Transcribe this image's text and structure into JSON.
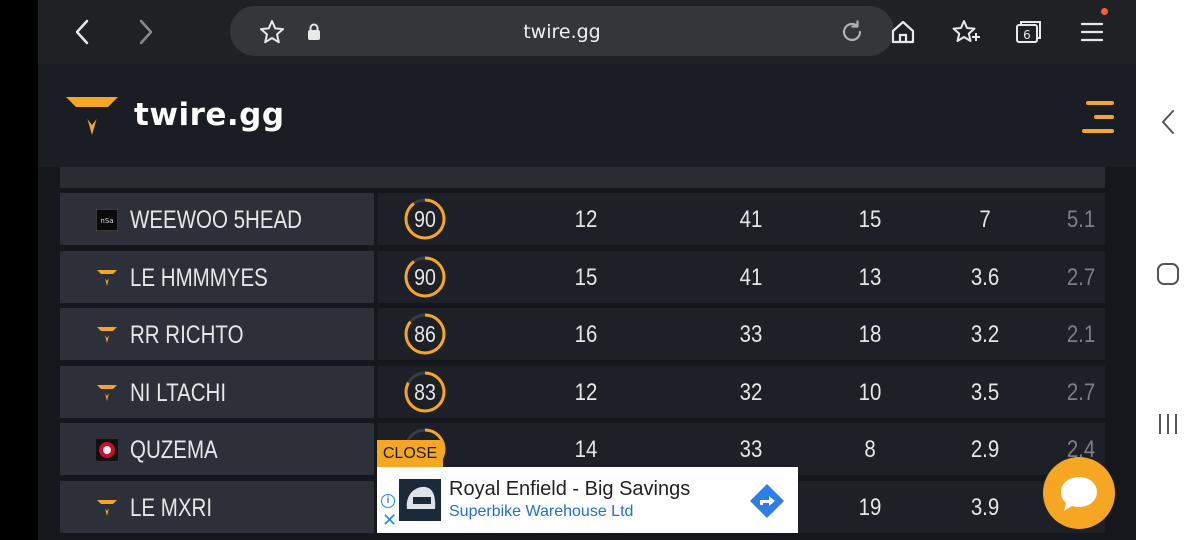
{
  "browser": {
    "url": "twire.gg",
    "tab_count": "6",
    "icons": [
      "back-arrow-icon",
      "forward-arrow-icon",
      "star-icon",
      "lock-icon",
      "reload-icon",
      "home-icon",
      "bookmark-add-icon",
      "tabs-icon",
      "menu-icon"
    ]
  },
  "site": {
    "logo_text": "twire.gg",
    "accent": "#f5a623"
  },
  "table": {
    "rows": [
      {
        "name": "WEEWOO 5HEAD",
        "logo": "nSa",
        "rating": "90",
        "rating_pct": 0.9,
        "col1": "12",
        "col2": "41",
        "col3": "15",
        "col4": "7",
        "col5": "5.1"
      },
      {
        "name": "LE HMMMYES",
        "logo": "twire",
        "rating": "90",
        "rating_pct": 0.9,
        "col1": "15",
        "col2": "41",
        "col3": "13",
        "col4": "3.6",
        "col5": "2.7"
      },
      {
        "name": "RR RICHTO",
        "logo": "twire",
        "rating": "86",
        "rating_pct": 0.86,
        "col1": "16",
        "col2": "33",
        "col3": "18",
        "col4": "3.2",
        "col5": "2.1"
      },
      {
        "name": "NI LTACHI",
        "logo": "twire",
        "rating": "83",
        "rating_pct": 0.83,
        "col1": "12",
        "col2": "32",
        "col3": "10",
        "col4": "3.5",
        "col5": "2.7"
      },
      {
        "name": "QUZEMA",
        "logo": "round",
        "rating": "",
        "rating_pct": 0.8,
        "col1": "14",
        "col2": "33",
        "col3": "8",
        "col4": "2.9",
        "col5": "2.4"
      },
      {
        "name": "LE MXRI",
        "logo": "twire",
        "rating": "",
        "rating_pct": 0.8,
        "col1": "",
        "col2": "",
        "col3": "19",
        "col4": "3.9",
        "col5": ""
      }
    ]
  },
  "ad": {
    "close_label": "CLOSE",
    "title": "Royal Enfield - Big Savings",
    "subtitle": "Superbike Warehouse Ltd",
    "info_glyph": "i",
    "x_glyph": "✕"
  }
}
